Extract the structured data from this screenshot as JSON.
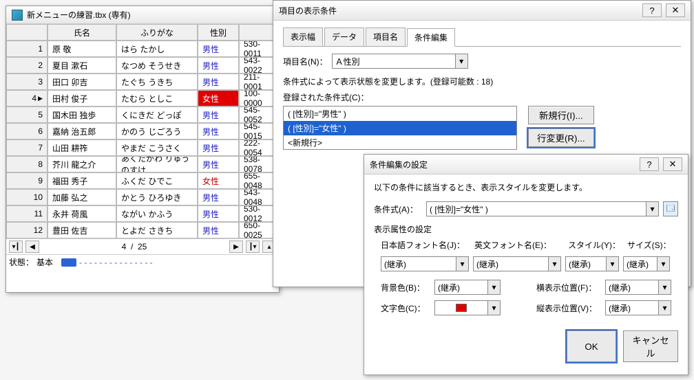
{
  "main_window": {
    "title": "新メニューの練習.tbx (専有)",
    "columns": [
      "",
      "氏名",
      "ふりがな",
      "性別",
      ""
    ],
    "rows": [
      {
        "n": "1",
        "name": "原 敬",
        "kana": "はら たかし",
        "sex": "男性",
        "sex_cls": "male",
        "zip": "530-0011"
      },
      {
        "n": "2",
        "name": "夏目 漱石",
        "kana": "なつめ そうせき",
        "sex": "男性",
        "sex_cls": "male",
        "zip": "543-0022"
      },
      {
        "n": "3",
        "name": "田口 卯吉",
        "kana": "たぐち うきち",
        "sex": "男性",
        "sex_cls": "male",
        "zip": "211-0001"
      },
      {
        "n": "4",
        "name": "田村 俊子",
        "kana": "たむら としこ",
        "sex": "女性",
        "sex_cls": "female",
        "zip": "100-0000",
        "cur": true
      },
      {
        "n": "5",
        "name": "国木田 独歩",
        "kana": "くにきだ どっぽ",
        "sex": "男性",
        "sex_cls": "male",
        "zip": "545-0052"
      },
      {
        "n": "6",
        "name": "嘉納 治五郎",
        "kana": "かのう じごろう",
        "sex": "男性",
        "sex_cls": "male",
        "zip": "545-0015"
      },
      {
        "n": "7",
        "name": "山田 耕筰",
        "kana": "やまだ こうさく",
        "sex": "男性",
        "sex_cls": "male",
        "zip": "222-0054"
      },
      {
        "n": "8",
        "name": "芥川 龍之介",
        "kana": "あくたがわ りゅうのすけ",
        "sex": "男性",
        "sex_cls": "male",
        "zip": "538-0078"
      },
      {
        "n": "9",
        "name": "福田 秀子",
        "kana": "ふくだ ひでこ",
        "sex": "女性",
        "sex_cls": "female-txt",
        "zip": "655-0048"
      },
      {
        "n": "10",
        "name": "加藤 弘之",
        "kana": "かとう ひろゆき",
        "sex": "男性",
        "sex_cls": "male",
        "zip": "543-0048"
      },
      {
        "n": "11",
        "name": "永井 荷風",
        "kana": "ながい かふう",
        "sex": "男性",
        "sex_cls": "male",
        "zip": "530-0012"
      },
      {
        "n": "12",
        "name": "豊田 佐吉",
        "kana": "とよだ さきち",
        "sex": "男性",
        "sex_cls": "male",
        "zip": "650-0025"
      }
    ],
    "counter_cur": "4",
    "counter_sep": "/",
    "counter_total": "25",
    "status_lbl": "状態：",
    "status_val": "基本"
  },
  "dlg1": {
    "title": "項目の表示条件",
    "tabs": [
      "表示幅",
      "データ",
      "項目名",
      "条件編集"
    ],
    "active_tab": 3,
    "item_lbl": "項目名(N)：",
    "item_sel": "Ａ性別",
    "cond_note": "条件式によって表示状態を変更します。(登録可能数 : 18)",
    "regd_lbl": "登録された条件式(C)：",
    "btn_new": "新規行(I)...",
    "btn_chg": "行変更(R)...",
    "list": [
      {
        "txt": "( [性別]=\"男性\" )",
        "sel": false
      },
      {
        "txt": "( [性別]=\"女性\" )",
        "sel": true
      },
      {
        "txt": "<新規行>",
        "sel": false
      }
    ]
  },
  "dlg2": {
    "title": "条件編集の設定",
    "note": "以下の条件に該当するとき、表示スタイルを変更します。",
    "cond_lbl": "条件式(A)：",
    "cond_val": "( [性別]=\"女性\" )",
    "attr_hdr": "表示属性の設定",
    "jfont_lbl": "日本語フォント名(J)：",
    "efont_lbl": "英文フォント名(E)：",
    "style_lbl": "スタイル(Y)：",
    "size_lbl": "サイズ(S)：",
    "inherit": "(継承)",
    "bg_lbl": "背景色(B)：",
    "fg_lbl": "文字色(C)：",
    "halign_lbl": "横表示位置(F)：",
    "valign_lbl": "縦表示位置(V)：",
    "ok": "OK",
    "cancel": "キャンセル"
  }
}
